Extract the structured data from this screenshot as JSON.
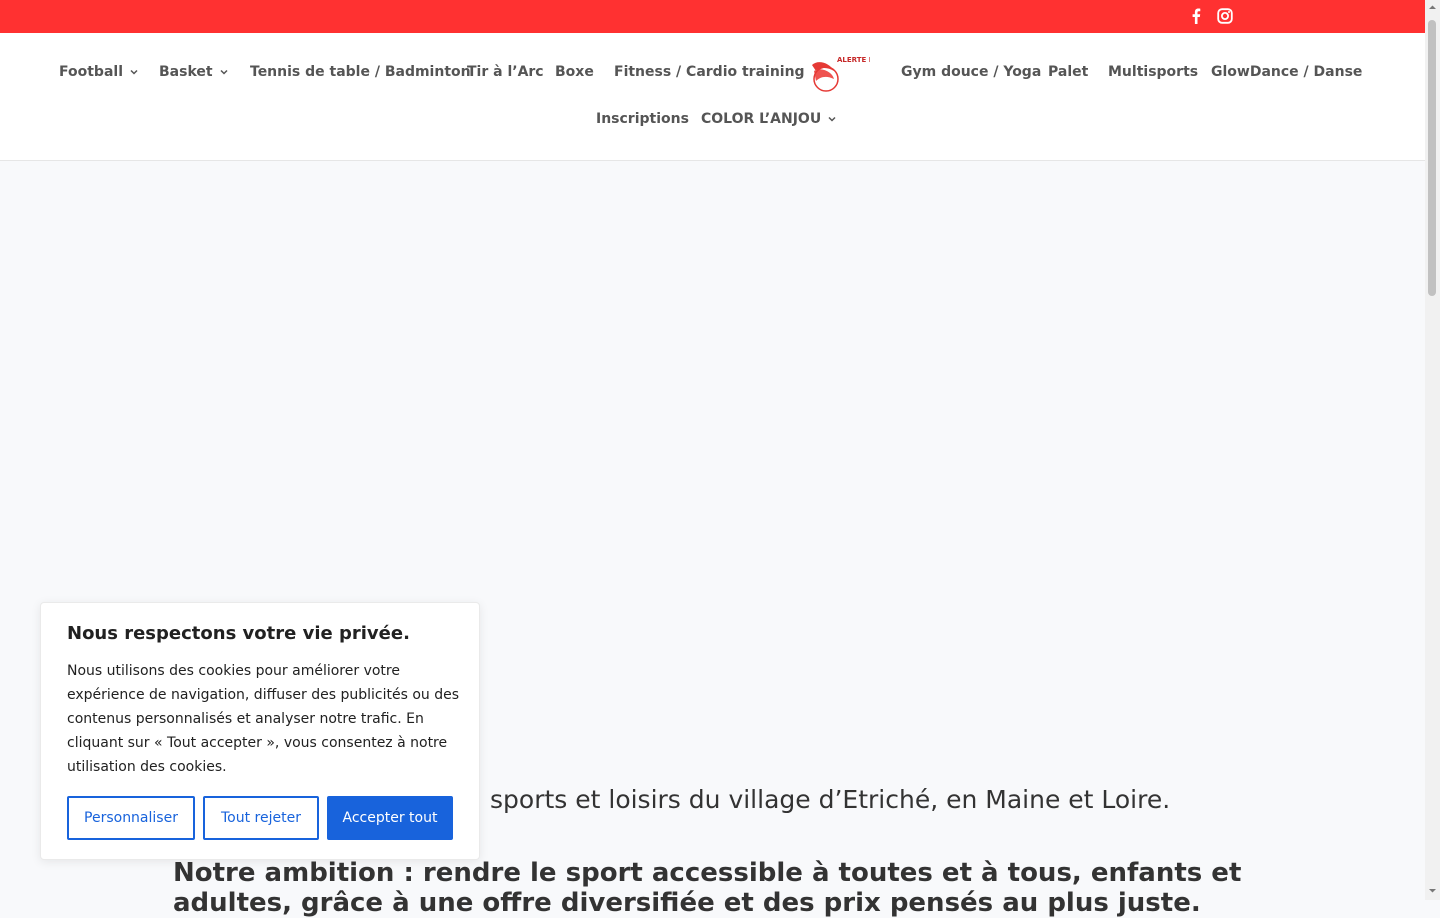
{
  "colors": {
    "topbar": "#ff3131",
    "accent_blue": "#1863dc",
    "nav_text": "#555555"
  },
  "topbar": {
    "icons": [
      "facebook-icon",
      "instagram-icon"
    ]
  },
  "nav": {
    "items": [
      {
        "label": "Football",
        "has_submenu": true
      },
      {
        "label": "Basket",
        "has_submenu": true
      },
      {
        "label": "Tennis de table / Badminton"
      },
      {
        "label": "Tir à l’Arc"
      },
      {
        "label": "Boxe"
      },
      {
        "label": "Fitness / Cardio training"
      },
      {
        "label": "Gym douce / Yoga"
      },
      {
        "label": "Palet"
      },
      {
        "label": "Multisports"
      },
      {
        "label": "GlowDance / Danse"
      },
      {
        "label": "Inscriptions"
      },
      {
        "label": "COLOR L’ANJOU",
        "has_submenu": true
      }
    ],
    "logo_text": "ALERTE ETRICHE"
  },
  "content": {
    "intro_visible": "sports et loisirs du village d’Etriché, en Maine et Loire.",
    "ambition": "Notre ambition : rendre le sport accessible à toutes et à tous, enfants et adultes, grâce à une offre diversifiée et des prix pensés au plus juste."
  },
  "cookie": {
    "title": "Nous respectons votre vie privée.",
    "text": "Nous utilisons des cookies pour améliorer votre expérience de navigation, diffuser des publicités ou des contenus personnalisés et analyser notre trafic. En cliquant sur « Tout accepter », vous consentez à notre utilisation des cookies.",
    "customize": "Personnaliser",
    "reject": "Tout rejeter",
    "accept": "Accepter tout"
  }
}
